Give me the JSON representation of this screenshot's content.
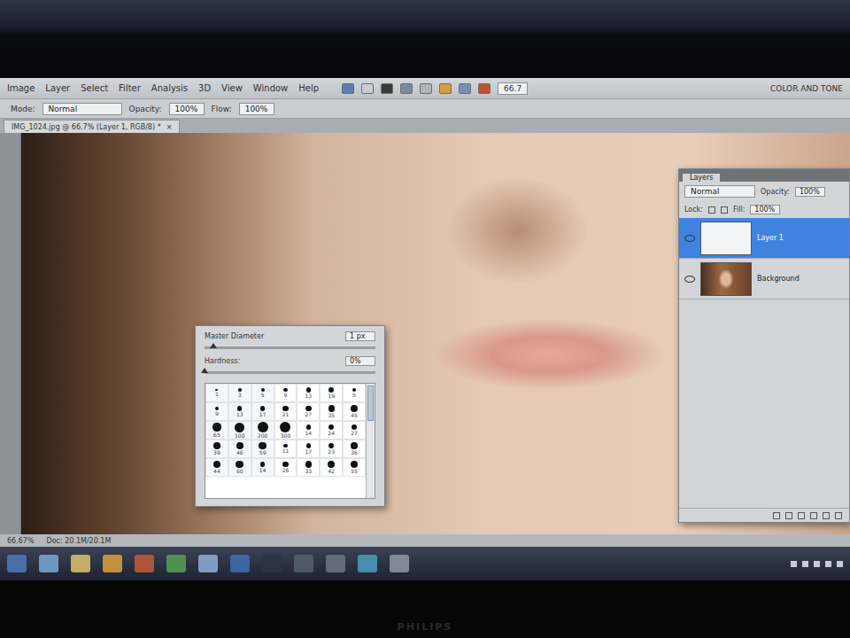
{
  "menu": [
    "Image",
    "Layer",
    "Select",
    "Filter",
    "Analysis",
    "3D",
    "View",
    "Window",
    "Help"
  ],
  "zoom_field": "66.7",
  "workspace": "COLOR AND TONE",
  "options": {
    "mode_label": "Mode:",
    "mode": "Normal",
    "opacity_label": "Opacity:",
    "opacity": "100%",
    "flow_label": "Flow:",
    "flow": "100%"
  },
  "document_tab": {
    "title": "IMG_1024.jpg @ 66.7% (Layer 1, RGB/8) *",
    "close": "×"
  },
  "brush_picker": {
    "diameter_label": "Master Diameter",
    "diameter": "1 px",
    "diameter_level": 0.05,
    "hardness_label": "Hardness:",
    "hardness": "0%",
    "hardness_level": 0.0,
    "brushes": [
      "1",
      "3",
      "5",
      "9",
      "13",
      "19",
      "5",
      "9",
      "13",
      "17",
      "21",
      "27",
      "35",
      "45",
      "65",
      "100",
      "200",
      "300",
      "14",
      "24",
      "27",
      "39",
      "46",
      "59",
      "11",
      "17",
      "23",
      "36",
      "44",
      "60",
      "14",
      "26",
      "33",
      "42",
      "55"
    ]
  },
  "layers_panel": {
    "tab": "Layers",
    "blend": "Normal",
    "opacity_label": "Opacity:",
    "opacity": "100%",
    "lock_label": "Lock:",
    "fill_label": "Fill:",
    "fill": "100%",
    "layers": [
      {
        "name": "Layer 1",
        "selected": true,
        "kind": "blank"
      },
      {
        "name": "Background",
        "selected": false,
        "kind": "photo"
      }
    ]
  },
  "status": {
    "zoom": "66.67%",
    "doc": "Doc: 20.1M/20.1M"
  },
  "bezel_brand": "PHILIPS"
}
